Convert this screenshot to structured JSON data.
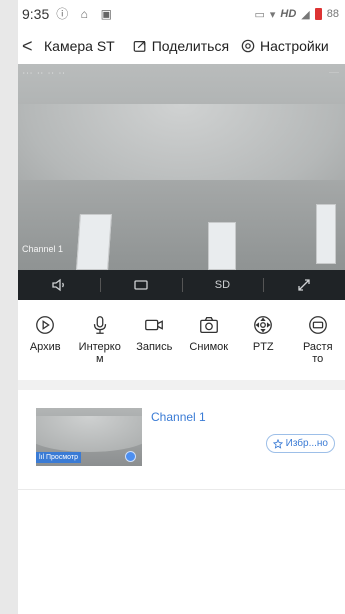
{
  "statusbar": {
    "time": "9:35",
    "network": "HD",
    "battery": "88"
  },
  "header": {
    "back": "<",
    "title": "Камера ST",
    "share": "Поделиться",
    "settings": "Настройки"
  },
  "video": {
    "channel_overlay": "Channel 1"
  },
  "video_bar": {
    "quality": "SD"
  },
  "tools": [
    {
      "label": "Архив",
      "icon": "play-circle-icon"
    },
    {
      "label": "Интерко\nм",
      "icon": "microphone-icon"
    },
    {
      "label": "Запись",
      "icon": "video-record-icon"
    },
    {
      "label": "Снимок",
      "icon": "camera-icon"
    },
    {
      "label": "PTZ",
      "icon": "ptz-icon"
    },
    {
      "label": "Растя\nто",
      "icon": "stretch-icon"
    }
  ],
  "channel": {
    "name": "Channel 1",
    "badge": "Просмотр",
    "favorite": "Избр...но"
  }
}
